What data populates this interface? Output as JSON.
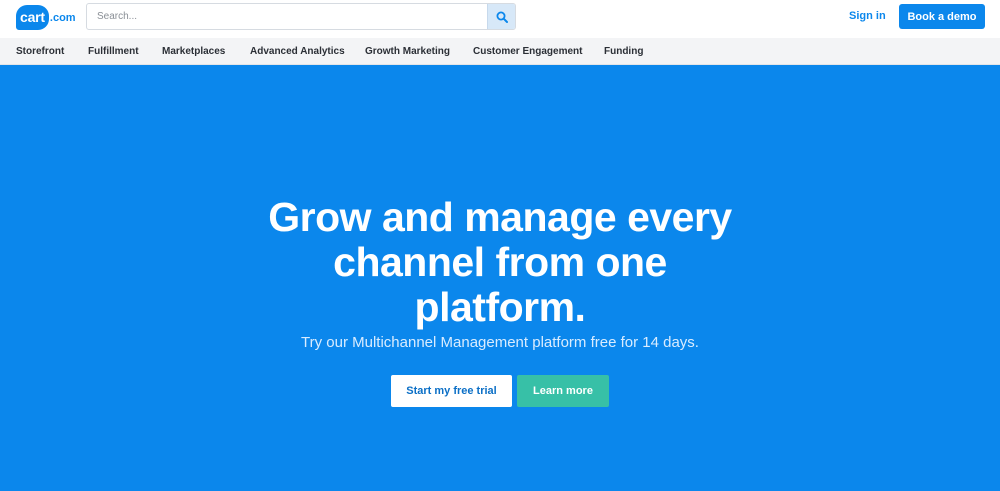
{
  "brand": {
    "logo_main": "cart",
    "logo_suffix": ".com",
    "accent": "#0b87ec"
  },
  "header": {
    "search_placeholder": "Search...",
    "search_icon": "search-icon",
    "signin_label": "Sign in",
    "demo_label": "Book a demo"
  },
  "nav": {
    "items": [
      {
        "label": "Storefront"
      },
      {
        "label": "Fulfillment"
      },
      {
        "label": "Marketplaces"
      },
      {
        "label": "Advanced Analytics"
      },
      {
        "label": "Growth Marketing"
      },
      {
        "label": "Customer Engagement"
      },
      {
        "label": "Funding"
      }
    ]
  },
  "hero": {
    "title_line1": "Grow and manage every",
    "title_line2": "channel from one",
    "title_line3": "platform.",
    "subtitle": "Try our Multichannel Management platform free for 14 days.",
    "trial_label": "Start my free trial",
    "learn_label": "Learn more",
    "background": "#0b87ec",
    "learn_color": "#37c0a7"
  }
}
